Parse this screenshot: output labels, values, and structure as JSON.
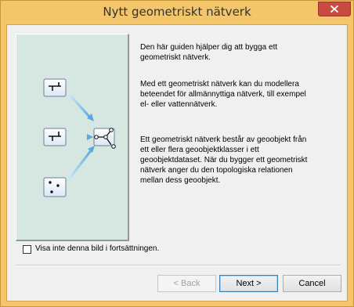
{
  "window": {
    "title": "Nytt geometriskt nätverk",
    "accent_color": "#f4c66b",
    "close_button_color": "#c74b3f"
  },
  "graphic": {
    "background_color": "#d6e6e0",
    "icons": [
      "line-feature-icon",
      "line-feature-icon",
      "point-feature-icon",
      "network-icon"
    ]
  },
  "content": {
    "paragraph_1": "Den här guiden hjälper dig att bygga ett\ngeometriskt nätverk.",
    "paragraph_2": "Med ett geometriskt nätverk kan du modellera\nbeteendet för allmännyttiga nätverk, till exempel\nel- eller vattennätverk.",
    "paragraph_3": "Ett geometriskt nätverk består av geoobjekt från\nett eller flera geoobjektklasser i ett\ngeoobjektdataset. När du bygger ett geometriskt\nnätverk anger du den topologiska relationen\nmellan dess geoobjekt."
  },
  "options": {
    "dont_show_label": "Visa inte denna bild i fortsättningen.",
    "dont_show_checked": false
  },
  "buttons": {
    "back_label": "< Back",
    "next_label": "Next >",
    "cancel_label": "Cancel"
  }
}
